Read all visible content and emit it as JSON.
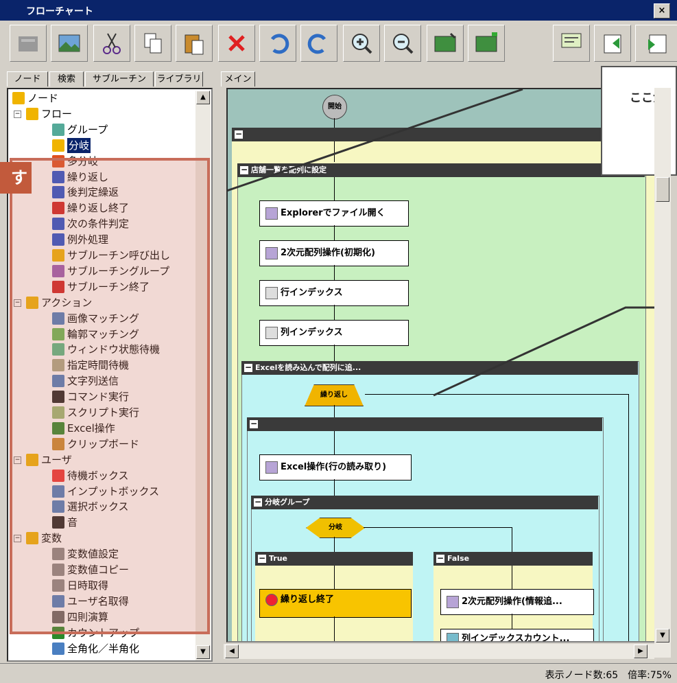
{
  "window": {
    "title": "フローチャート",
    "close": "×"
  },
  "tabs": [
    "ノード",
    "検索",
    "サブルーチン",
    "ライブラリ"
  ],
  "right_tab": "メイン",
  "tree": [
    {
      "label": "ノード",
      "depth": 0
    },
    {
      "label": "フロー",
      "depth": 1
    },
    {
      "label": "グループ",
      "depth": 2
    },
    {
      "label": "分岐",
      "depth": 2,
      "selected": true
    },
    {
      "label": "多分岐",
      "depth": 2
    },
    {
      "label": "繰り返し",
      "depth": 2
    },
    {
      "label": "後判定繰返",
      "depth": 2
    },
    {
      "label": "繰り返し終了",
      "depth": 2
    },
    {
      "label": "次の条件判定",
      "depth": 2
    },
    {
      "label": "例外処理",
      "depth": 2
    },
    {
      "label": "サブルーチン呼び出し",
      "depth": 2
    },
    {
      "label": "サブルーチングループ",
      "depth": 2
    },
    {
      "label": "サブルーチン終了",
      "depth": 2
    },
    {
      "label": "アクション",
      "depth": 1
    },
    {
      "label": "画像マッチング",
      "depth": 2
    },
    {
      "label": "輪郭マッチング",
      "depth": 2
    },
    {
      "label": "ウィンドウ状態待機",
      "depth": 2
    },
    {
      "label": "指定時間待機",
      "depth": 2
    },
    {
      "label": "文字列送信",
      "depth": 2
    },
    {
      "label": "コマンド実行",
      "depth": 2
    },
    {
      "label": "スクリプト実行",
      "depth": 2
    },
    {
      "label": "Excel操作",
      "depth": 2
    },
    {
      "label": "クリップボード",
      "depth": 2
    },
    {
      "label": "ユーザ",
      "depth": 1
    },
    {
      "label": "待機ボックス",
      "depth": 2
    },
    {
      "label": "インプットボックス",
      "depth": 2
    },
    {
      "label": "選択ボックス",
      "depth": 2
    },
    {
      "label": "音",
      "depth": 2
    },
    {
      "label": "変数",
      "depth": 1
    },
    {
      "label": "変数値設定",
      "depth": 2
    },
    {
      "label": "変数値コピー",
      "depth": 2
    },
    {
      "label": "日時取得",
      "depth": 2
    },
    {
      "label": "ユーザ名取得",
      "depth": 2
    },
    {
      "label": "四則演算",
      "depth": 2
    },
    {
      "label": "カウントアップ",
      "depth": 2
    },
    {
      "label": "全角化／半角化",
      "depth": 2
    }
  ],
  "flow": {
    "start": "開始",
    "group_main": "",
    "group_store": "店舗一覧を配列に設定",
    "box1": "Explorerでファイル開く",
    "box2": "2次元配列操作(初期化)",
    "box3": "行インデックス",
    "box4": "列インデックス",
    "group_excel": "Excelを読み込んで配列に追...",
    "loop": "繰り返し",
    "group_inner": "",
    "box5": "Excel操作(行の読み取り)",
    "group_branch": "分岐グループ",
    "branch": "分岐",
    "true_head": "True",
    "false_head": "False",
    "loop_end": "繰り返し終了",
    "box6": "2次元配列操作(情報追...",
    "box7": "列インデックスカウント..."
  },
  "callout": {
    "tag": "す",
    "annotation": "ここが"
  },
  "status": "表示ノード数:65　倍率:75%"
}
